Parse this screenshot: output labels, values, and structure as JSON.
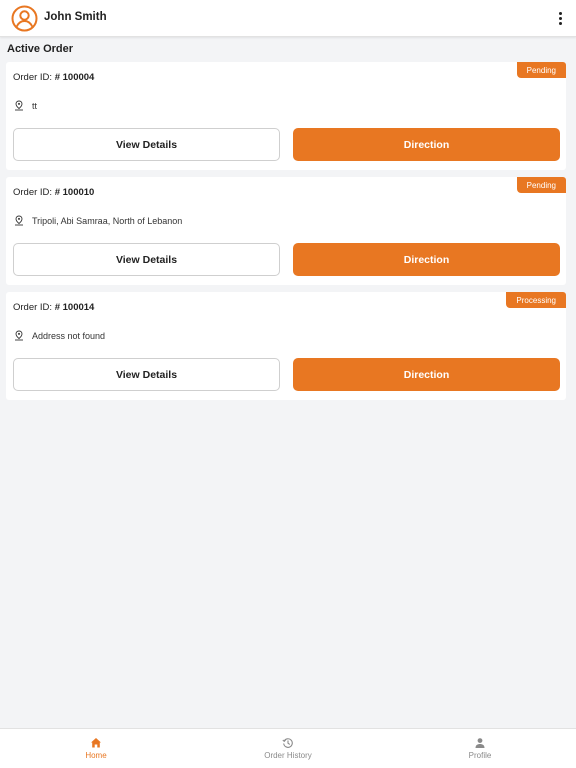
{
  "header": {
    "user_name": "John Smith"
  },
  "section_title": "Active Order",
  "orders": [
    {
      "order_id_label": "Order ID: ",
      "order_id": "# 100004",
      "status": "Pending",
      "address": "tt",
      "view_details_label": "View Details",
      "direction_label": "Direction"
    },
    {
      "order_id_label": "Order ID: ",
      "order_id": "# 100010",
      "status": "Pending",
      "address": "Tripoli, Abi Samraa, North of Lebanon",
      "view_details_label": "View Details",
      "direction_label": "Direction"
    },
    {
      "order_id_label": "Order ID: ",
      "order_id": "# 100014",
      "status": "Processing",
      "address": "Address not found",
      "view_details_label": "View Details",
      "direction_label": "Direction"
    }
  ],
  "bottom_nav": {
    "items": [
      {
        "label": "Home",
        "icon": "home-icon",
        "active": true
      },
      {
        "label": "Order History",
        "icon": "history-icon",
        "active": false
      },
      {
        "label": "Profile",
        "icon": "person-icon",
        "active": false
      }
    ]
  },
  "colors": {
    "accent": "#e87722",
    "background": "#f3f4f6",
    "card": "#ffffff",
    "inactive_nav": "#8a8a8a"
  }
}
